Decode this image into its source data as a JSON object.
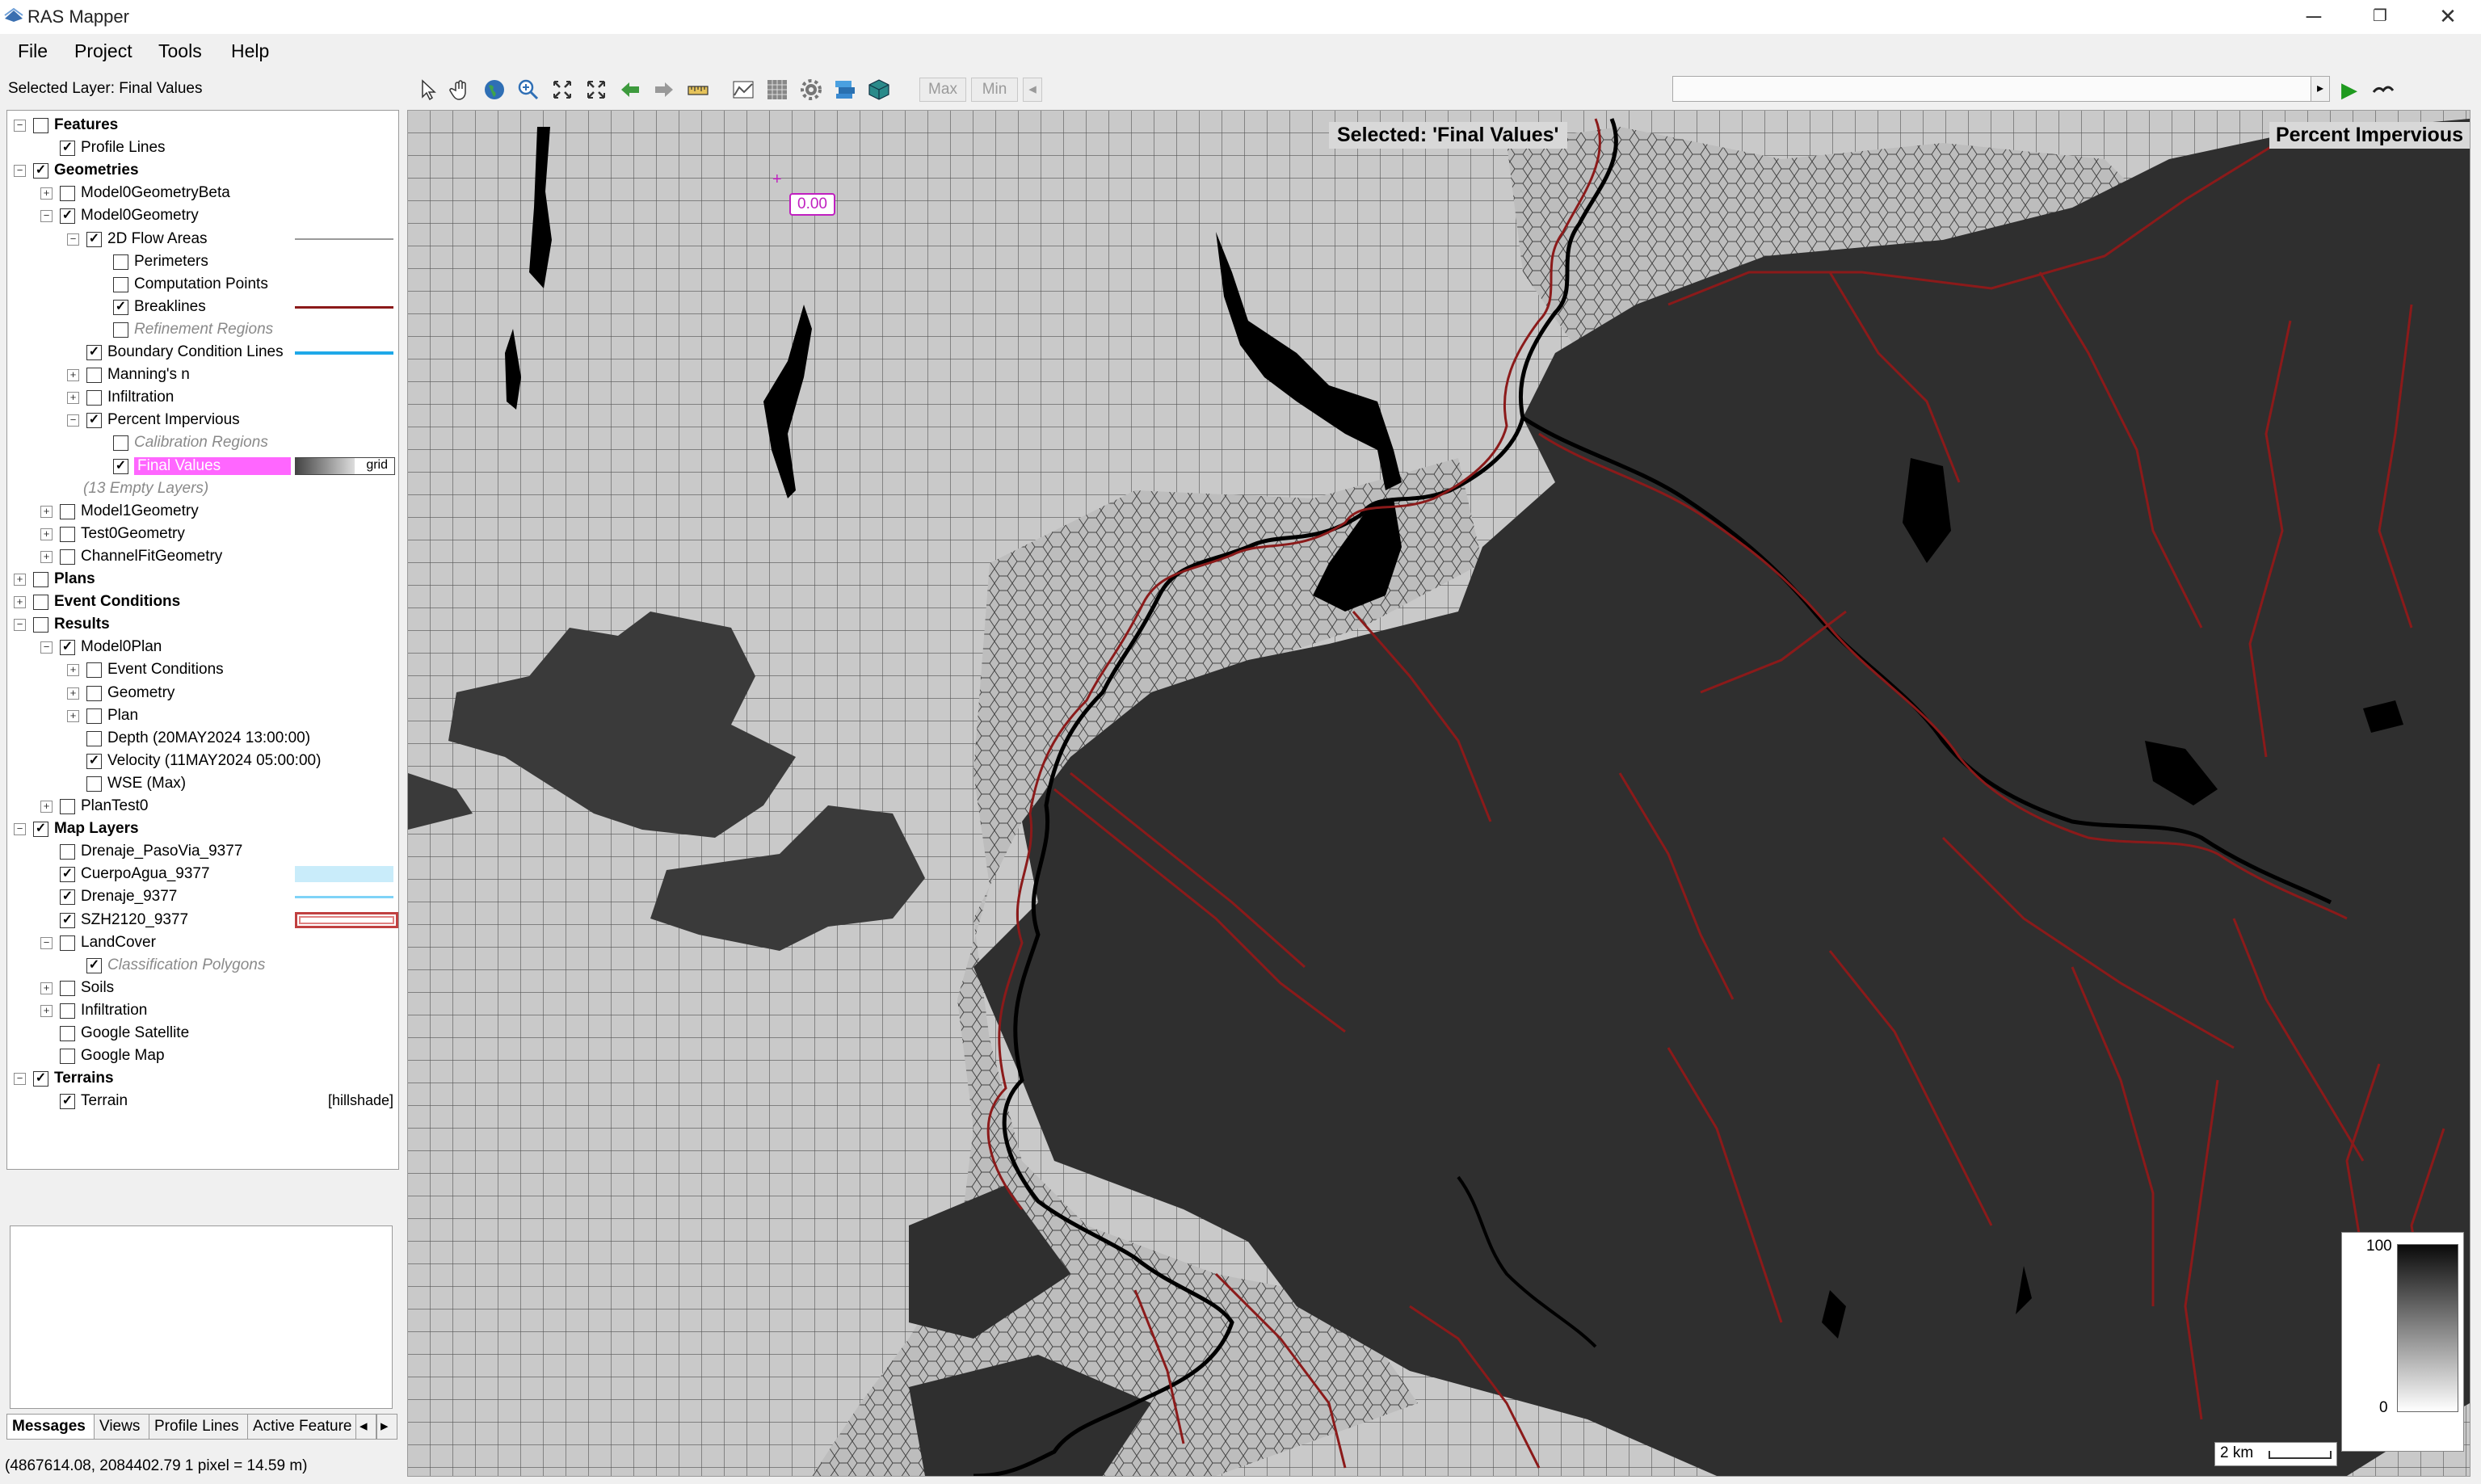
{
  "app": {
    "title": "RAS Mapper"
  },
  "window_controls": {
    "minimize": "─",
    "restore": "❐",
    "close": "✕"
  },
  "menu": [
    "File",
    "Project",
    "Tools",
    "Help"
  ],
  "selected_layer_label": "Selected Layer: Final Values",
  "toolbar": {
    "icons": [
      "select-arrow-icon",
      "pan-hand-icon",
      "globe-icon",
      "zoom-in-icon",
      "zoom-full-icon",
      "zoom-extent-icon",
      "back-arrow-icon",
      "forward-arrow-icon",
      "measure-ruler-icon",
      "profile-chart-icon",
      "grid-icon",
      "tool-gear-icon",
      "layers-icon",
      "cube-icon"
    ],
    "max_label": "Max",
    "min_label": "Min",
    "slider_left_arrow": "◂",
    "slider_right_arrow": "▸",
    "play_icon": "▶"
  },
  "layer_tree": [
    {
      "level": 0,
      "expander": "⊟",
      "checked": false,
      "label": "Features",
      "style": "bold"
    },
    {
      "level": 1,
      "expander": "",
      "checked": true,
      "label": "Profile Lines"
    },
    {
      "level": 0,
      "expander": "⊟",
      "checked": true,
      "label": "Geometries",
      "style": "bold"
    },
    {
      "level": 1,
      "expander": "⊞",
      "checked": false,
      "label": "Model0GeometryBeta"
    },
    {
      "level": 1,
      "expander": "⊟",
      "checked": true,
      "label": "Model0Geometry"
    },
    {
      "level": 2,
      "expander": "⊟",
      "checked": true,
      "label": "2D Flow Areas",
      "legend": "line-gray"
    },
    {
      "level": 3,
      "expander": "",
      "checked": false,
      "label": "Perimeters"
    },
    {
      "level": 3,
      "expander": "",
      "checked": false,
      "label": "Computation Points"
    },
    {
      "level": 3,
      "expander": "",
      "checked": true,
      "label": "Breaklines",
      "legend": "line-darkred"
    },
    {
      "level": 3,
      "expander": "",
      "checked": false,
      "label": "Refinement Regions",
      "style": "italic"
    },
    {
      "level": 2,
      "expander": "",
      "checked": true,
      "label": "Boundary Condition Lines",
      "legend": "line-blue"
    },
    {
      "level": 2,
      "expander": "⊞",
      "checked": false,
      "label": "Manning's n"
    },
    {
      "level": 2,
      "expander": "⊞",
      "checked": false,
      "label": "Infiltration"
    },
    {
      "level": 2,
      "expander": "⊟",
      "checked": true,
      "label": "Percent Impervious"
    },
    {
      "level": 3,
      "expander": "",
      "checked": false,
      "label": "Calibration Regions",
      "style": "italic"
    },
    {
      "level": 3,
      "expander": "",
      "checked": true,
      "label": "Final Values",
      "style": "highlight",
      "legend": "grid",
      "legend_text": "grid"
    },
    {
      "level": 2,
      "expander": "",
      "checked": null,
      "label": "(13 Empty Layers)",
      "style": "italic"
    },
    {
      "level": 1,
      "expander": "⊞",
      "checked": false,
      "label": "Model1Geometry"
    },
    {
      "level": 1,
      "expander": "⊞",
      "checked": false,
      "label": "Test0Geometry"
    },
    {
      "level": 1,
      "expander": "⊞",
      "checked": false,
      "label": "ChannelFitGeometry"
    },
    {
      "level": 0,
      "expander": "⊞",
      "checked": false,
      "label": "Plans",
      "style": "bold"
    },
    {
      "level": 0,
      "expander": "⊞",
      "checked": false,
      "label": "Event Conditions",
      "style": "bold"
    },
    {
      "level": 0,
      "expander": "⊟",
      "checked": false,
      "label": "Results",
      "style": "bold"
    },
    {
      "level": 1,
      "expander": "⊟",
      "checked": true,
      "label": "Model0Plan"
    },
    {
      "level": 2,
      "expander": "⊞",
      "checked": false,
      "label": "Event Conditions"
    },
    {
      "level": 2,
      "expander": "⊞",
      "checked": false,
      "label": "Geometry"
    },
    {
      "level": 2,
      "expander": "⊞",
      "checked": false,
      "label": "Plan"
    },
    {
      "level": 2,
      "expander": "",
      "checked": false,
      "label": "Depth (20MAY2024 13:00:00)"
    },
    {
      "level": 2,
      "expander": "",
      "checked": true,
      "label": "Velocity (11MAY2024 05:00:00)"
    },
    {
      "level": 2,
      "expander": "",
      "checked": false,
      "label": "WSE (Max)"
    },
    {
      "level": 1,
      "expander": "⊞",
      "checked": false,
      "label": "PlanTest0"
    },
    {
      "level": 0,
      "expander": "⊟",
      "checked": true,
      "label": "Map Layers",
      "style": "bold"
    },
    {
      "level": 1,
      "expander": "",
      "checked": false,
      "label": "Drenaje_PasoVia_9377"
    },
    {
      "level": 1,
      "expander": "",
      "checked": true,
      "label": "CuerpoAgua_9377",
      "legend": "fill-lightblue"
    },
    {
      "level": 1,
      "expander": "",
      "checked": true,
      "label": "Drenaje_9377",
      "legend": "line-lightblue"
    },
    {
      "level": 1,
      "expander": "",
      "checked": true,
      "label": "SZH2120_9377",
      "legend": "box-red"
    },
    {
      "level": 1,
      "expander": "⊟",
      "checked": false,
      "label": "LandCover"
    },
    {
      "level": 2,
      "expander": "",
      "checked": true,
      "label": "Classification Polygons",
      "style": "italic"
    },
    {
      "level": 1,
      "expander": "⊞",
      "checked": false,
      "label": "Soils"
    },
    {
      "level": 1,
      "expander": "⊞",
      "checked": false,
      "label": "Infiltration"
    },
    {
      "level": 1,
      "expander": "",
      "checked": false,
      "label": "Google Satellite"
    },
    {
      "level": 1,
      "expander": "",
      "checked": false,
      "label": "Google Map"
    },
    {
      "level": 0,
      "expander": "⊟",
      "checked": true,
      "label": "Terrains",
      "style": "bold"
    },
    {
      "level": 1,
      "expander": "",
      "checked": true,
      "label": "Terrain",
      "extra": "[hillshade]"
    }
  ],
  "bottom_tabs": [
    "Messages",
    "Views",
    "Profile Lines",
    "Active Feature"
  ],
  "tab_scroll": {
    "left": "◂",
    "right": "▸"
  },
  "status_bar": "(4867614.08, 2084402.79  1 pixel = 14.59 m)",
  "map": {
    "selected_text": "Selected: 'Final Values'",
    "layer_title": "Percent Impervious",
    "probe_value": "0.00",
    "legend": {
      "max": "100",
      "min": "0"
    },
    "scale_label": "2 km",
    "colors": {
      "grid_bg": "#c9c9c9",
      "grid_line": "#555555",
      "dark_fill": "#2f2f2f",
      "breakline": "#8b1a1a",
      "river": "#000000"
    }
  }
}
